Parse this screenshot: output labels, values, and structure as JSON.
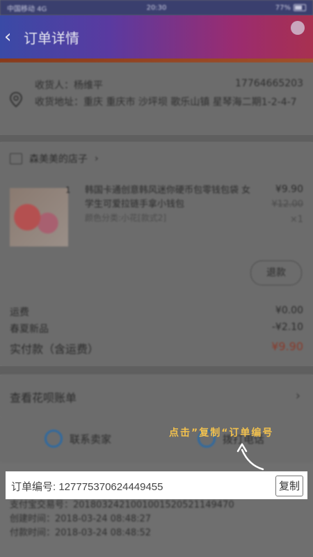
{
  "status_bar": {
    "carrier": "中国移动 4G",
    "time": "20:30",
    "battery": "77%"
  },
  "header": {
    "title": "订单详情"
  },
  "address": {
    "receiver": "收货人：杨维平",
    "phone": "17764665203",
    "detail": "收货地址：重庆 重庆市 沙坪坝 歌乐山镇 星琴海二期1-2-4-7"
  },
  "order": {
    "shop_name": "森美美的店子",
    "item": {
      "qty_prefix": "1",
      "name": "韩国卡通创意韩风迷你硬币包零钱包袋 女学生可爱拉链手拿小钱包",
      "spec": "颜色分类:小花[款式2]",
      "price": "¥9.90",
      "original_price": "¥12.00",
      "quantity": "×1"
    },
    "refund_label": "退款",
    "summary": [
      {
        "label": "运费",
        "value": "¥0.00"
      },
      {
        "label": "春夏新品",
        "value": "-¥2.10"
      }
    ],
    "total_label": "实付款（含运费）",
    "total_value": "¥9.90"
  },
  "bill": {
    "label": "查看花呗账单"
  },
  "contact": {
    "seller": "联系卖家",
    "phone": "拨打电话"
  },
  "meta": {
    "alipay": "支付宝交易号：2018032421001001520521149470",
    "created": "创建时间：2018-03-24 08:48:27",
    "paid": "付款时间：2018-03-24 08:48:52"
  },
  "hint": "点击”复制“订单编号",
  "order_number": {
    "label": "订单编号: 127775370624449455",
    "copy_button": "复制"
  }
}
